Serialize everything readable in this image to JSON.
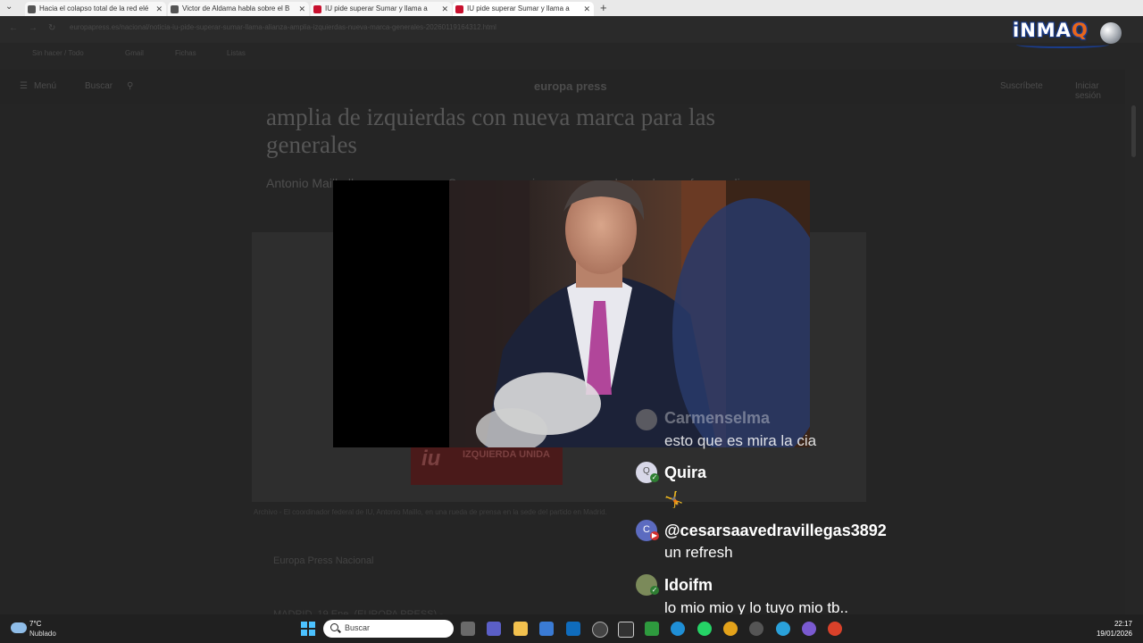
{
  "tabs": [
    {
      "label": "Hacia el colapso total de la red elé",
      "favicon": "doc-icon"
    },
    {
      "label": "Victor de Aldama habla sobre el B",
      "favicon": "doc-icon"
    },
    {
      "label": "IU pide superar Sumar y llama a",
      "favicon": "europapress-icon"
    },
    {
      "label": "IU pide superar Sumar y llama a",
      "favicon": "europapress-icon"
    }
  ],
  "browser": {
    "url": "europapress.es/nacional/noticia-iu-pide-superar-sumar-llama-alianza-amplia-izquierdas-nueva-marca-generales-20260119164312.html",
    "bookmarks": [
      "Sin hacer / Todo",
      "Gmail",
      "Fichas",
      "Listas"
    ],
    "site_menu": "Menú",
    "site_search": "Buscar",
    "site_logo": "europa press",
    "site_login": "Iniciar sesión",
    "site_register": "Suscríbete"
  },
  "article": {
    "headline": "amplia de izquierdas con nueva marca para las generales",
    "subtitle": "Antonio Maillo llama a superar a Sumar y anuncia una marca electoral que afea su alianza",
    "photo_sign": "iu",
    "photo_sign_text": "IZQUIERDA UNIDA",
    "caption": "Archivo - El coordinador federal de IU, Antonio Maillo, en una rueda de prensa en la sede del partido en Madrid.",
    "byline": "Europa Press Nacional",
    "dateline": "MADRID, 19 Ene. (EUROPA PRESS) -"
  },
  "logo": {
    "text_main": "iNMA",
    "text_accent": "Q"
  },
  "chat": {
    "messages": [
      {
        "author": "Carmenselma",
        "text": "esto que es mira la cia",
        "avatar_color": "#b9b0a0"
      },
      {
        "author": "Quira",
        "text": "🤸",
        "avatar_color": "#d8d8e8",
        "avatar_letter": "Q"
      },
      {
        "author": "@cesarsaavedravillegas3892",
        "text": "un refresh",
        "avatar_color": "#5c6bc0",
        "avatar_letter": "C"
      },
      {
        "author": "Idoifm",
        "text": "lo mio mio y lo tuyo mio tb..",
        "avatar_color": "#7b8a5a"
      }
    ]
  },
  "taskbar": {
    "temperature": "7°C",
    "weather": "Nublado",
    "search_placeholder": "Buscar",
    "time": "22:17",
    "date": "19/01/2026",
    "apps": [
      "task-view-icon",
      "teams-icon",
      "file-explorer-icon",
      "store-icon",
      "outlook-icon",
      "clock-app-icon",
      "unity-icon",
      "camtasia-icon",
      "edge-icon",
      "whatsapp-icon",
      "chrome-icon",
      "obs-icon",
      "telegram-icon",
      "app-icon",
      "record-icon"
    ]
  }
}
